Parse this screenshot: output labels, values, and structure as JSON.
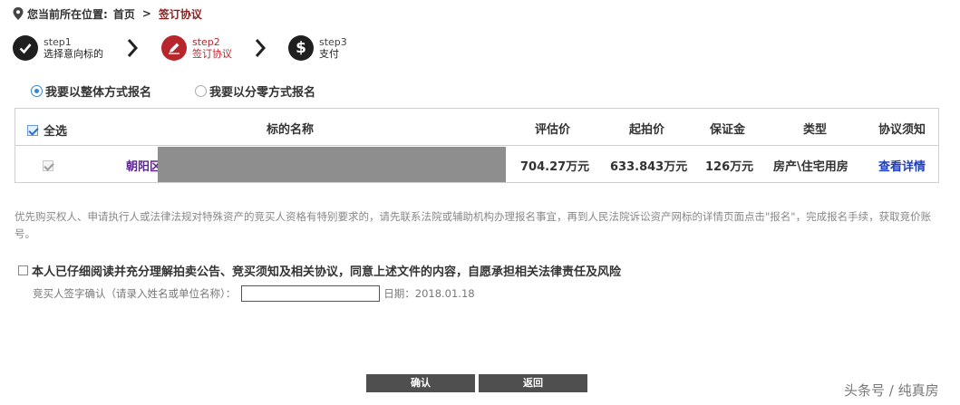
{
  "breadcrumb": {
    "prefix": "您当前所在位置:",
    "home": "首页",
    "separator": ">",
    "current": "签订协议"
  },
  "steps": [
    {
      "num": "step1",
      "label": "选择意向标的",
      "icon": "check-icon"
    },
    {
      "num": "step2",
      "label": "签订协议",
      "icon": "pen-icon"
    },
    {
      "num": "step3",
      "label": "支付",
      "icon": "dollar-icon"
    }
  ],
  "signup_mode": {
    "whole": "我要以整体方式报名",
    "partial": "我要以分零方式报名",
    "selected": "whole"
  },
  "table": {
    "headers": {
      "select_all": "全选",
      "name": "标的名称",
      "appraisal": "评估价",
      "start_price": "起拍价",
      "deposit": "保证金",
      "type": "类型",
      "agreement": "协议须知"
    },
    "rows": [
      {
        "name": "朝阳区",
        "appraisal": "704.27万元",
        "start_price": "633.843万元",
        "deposit": "126万元",
        "type": "房产\\住宅用房",
        "agreement": "查看详情"
      }
    ]
  },
  "notice": "优先购买权人、申请执行人或法律法规对特殊资产的竞买人资格有特别要求的，请先联系法院或辅助机构办理报名事宜，再到人民法院诉讼资产网标的详情页面点击\"报名\"，完成报名手续，获取竞价账号。",
  "agreement": {
    "label": "本人已仔细阅读并充分理解拍卖公告、竞买须知及相关协议，同意上述文件的内容，自愿承担相关法律责任及风险"
  },
  "signature": {
    "label": "竞买人签字确认（请录入姓名或单位名称）：",
    "value": "",
    "date_label": "日期：2018.01.18"
  },
  "buttons": {
    "confirm": "确认",
    "back": "返回"
  },
  "watermark": "头条号 / 纯真房",
  "colors": {
    "accent_red": "#b7262c",
    "link_blue": "#1f3fbf",
    "link_purple": "#5a2a8a",
    "button_bg": "#4f4f4f"
  }
}
